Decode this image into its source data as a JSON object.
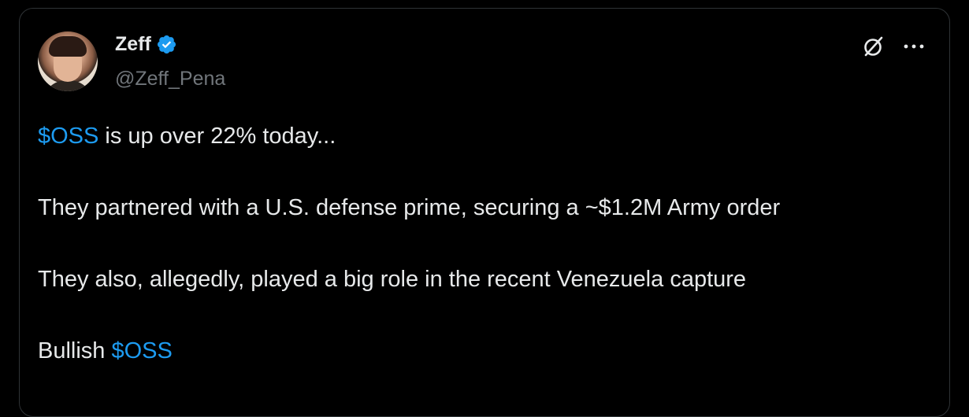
{
  "author": {
    "display_name": "Zeff",
    "handle": "@Zeff_Pena",
    "verified": true,
    "avatar_icon": "avatar-photo"
  },
  "actions": {
    "grok_icon": "grok-icon",
    "more_icon": "more-icon"
  },
  "tweet": {
    "p1": {
      "cashtag": "$OSS",
      "text": " is up over 22% today..."
    },
    "p2": "They partnered with a U.S. defense prime, securing a ~$1.2M Army order",
    "p3": "They also, allegedly, played a big role in the recent Venezuela capture",
    "p4": {
      "text": "Bullish ",
      "cashtag": "$OSS"
    }
  },
  "colors": {
    "background": "#000000",
    "text": "#e7e9ea",
    "secondary": "#71767b",
    "accent": "#1d9bf0",
    "border": "#2f3336"
  }
}
